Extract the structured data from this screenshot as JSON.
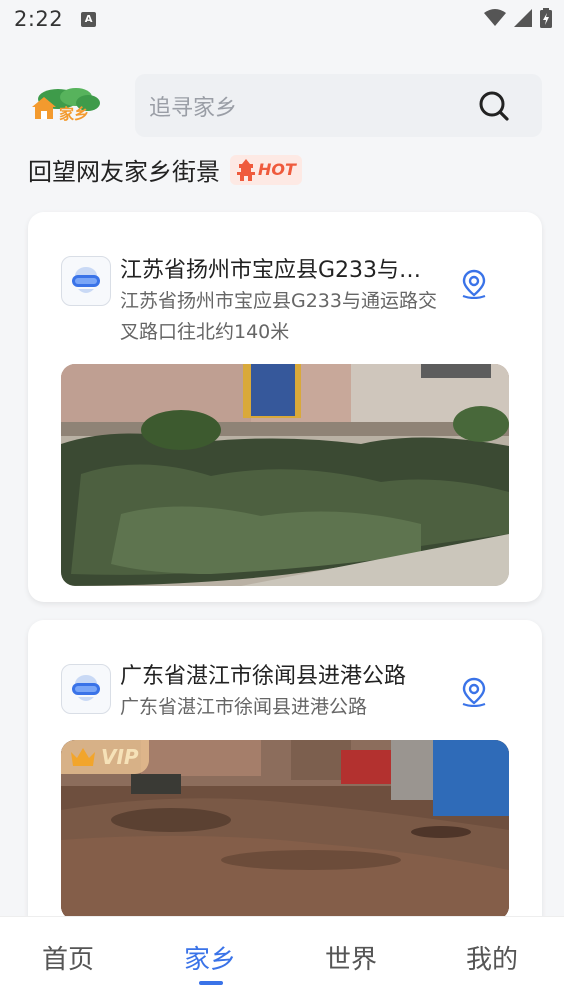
{
  "status_bar": {
    "time": "2:22",
    "notification_icon": "A"
  },
  "header": {
    "logo_text": "家乡",
    "search_placeholder": "追寻家乡"
  },
  "section": {
    "title": "回望网友家乡街景",
    "badge": "HOT"
  },
  "cards": [
    {
      "title": "江苏省扬州市宝应县G233与…",
      "subtitle": "江苏省扬州市宝应县G233与通运路交叉路口往北约140米",
      "vip": false
    },
    {
      "title": "广东省湛江市徐闻县进港公路",
      "subtitle": "广东省湛江市徐闻县进港公路",
      "vip": true,
      "vip_label": "VIP"
    }
  ],
  "tabs": [
    {
      "label": "首页"
    },
    {
      "label": "家乡"
    },
    {
      "label": "世界"
    },
    {
      "label": "我的"
    }
  ],
  "active_tab": "家乡",
  "colors": {
    "accent": "#3a73e8",
    "hot": "#ef5a3c",
    "vip": "#f0c896"
  }
}
